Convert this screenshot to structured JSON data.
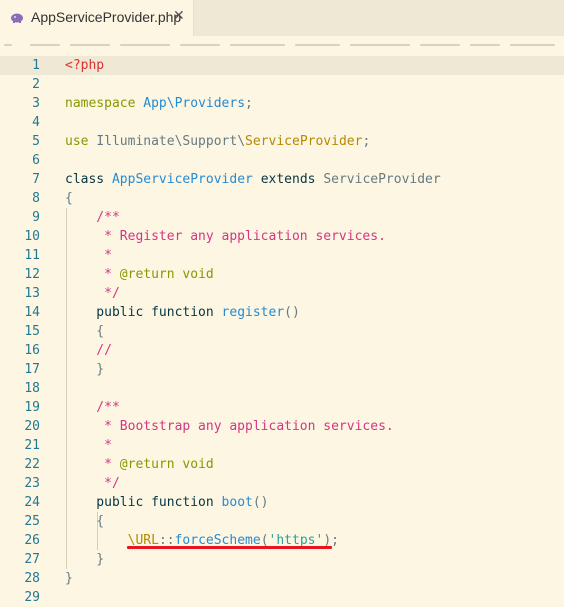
{
  "tab": {
    "title": "AppServiceProvider.php",
    "close_glyph": "✕",
    "icon": "php-elephant-icon"
  },
  "colors": {
    "accent_underline": "#e8141e",
    "line_number": "#237893",
    "background": "#fdf6e3"
  },
  "lines": [
    {
      "n": "1",
      "t": [
        "<?php"
      ]
    },
    {
      "n": "2",
      "t": []
    },
    {
      "n": "3",
      "t": [
        "namespace ",
        "App\\Providers",
        ";"
      ]
    },
    {
      "n": "4",
      "t": []
    },
    {
      "n": "5",
      "t": [
        "use ",
        "Illuminate\\Support\\",
        "ServiceProvider",
        ";"
      ]
    },
    {
      "n": "6",
      "t": []
    },
    {
      "n": "7",
      "t": [
        "class ",
        "AppServiceProvider ",
        "extends ",
        "ServiceProvider"
      ]
    },
    {
      "n": "8",
      "t": [
        "{"
      ]
    },
    {
      "n": "9",
      "t": [
        "    /**"
      ]
    },
    {
      "n": "10",
      "t": [
        "     * Register any application services."
      ]
    },
    {
      "n": "11",
      "t": [
        "     *"
      ]
    },
    {
      "n": "12",
      "t": [
        "     * ",
        "@return void"
      ]
    },
    {
      "n": "13",
      "t": [
        "     */"
      ]
    },
    {
      "n": "14",
      "t": [
        "    public function ",
        "register",
        "()"
      ]
    },
    {
      "n": "15",
      "t": [
        "    {"
      ]
    },
    {
      "n": "16",
      "t": [
        "    //"
      ]
    },
    {
      "n": "17",
      "t": [
        "    }"
      ]
    },
    {
      "n": "18",
      "t": []
    },
    {
      "n": "19",
      "t": [
        "    /**"
      ]
    },
    {
      "n": "20",
      "t": [
        "     * Bootstrap any application services."
      ]
    },
    {
      "n": "21",
      "t": [
        "     *"
      ]
    },
    {
      "n": "22",
      "t": [
        "     * ",
        "@return void"
      ]
    },
    {
      "n": "23",
      "t": [
        "     */"
      ]
    },
    {
      "n": "24",
      "t": [
        "    public function ",
        "boot",
        "()"
      ]
    },
    {
      "n": "25",
      "t": [
        "    {"
      ]
    },
    {
      "n": "26",
      "t": [
        "        ",
        "\\URL",
        "::",
        "forceScheme",
        "(",
        "'https'",
        ");"
      ]
    },
    {
      "n": "27",
      "t": [
        "    }"
      ]
    },
    {
      "n": "28",
      "t": [
        "}"
      ]
    },
    {
      "n": "29",
      "t": []
    }
  ]
}
